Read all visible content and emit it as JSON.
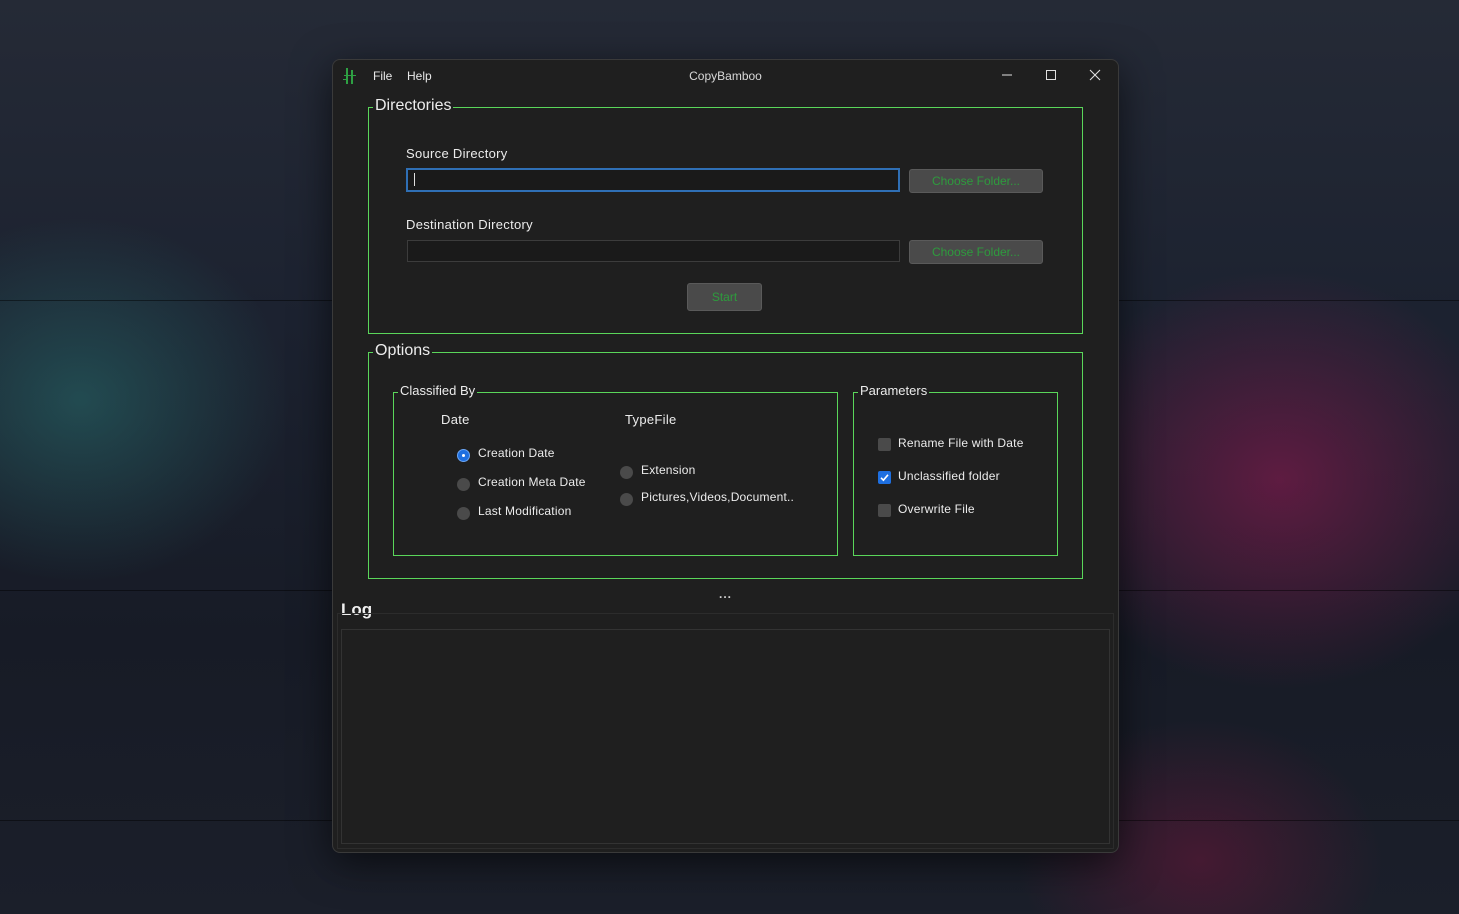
{
  "window": {
    "title": "CopyBamboo",
    "menu": [
      "File",
      "Help"
    ]
  },
  "directories": {
    "title": "Directories",
    "source_label": "Source Directory",
    "source_value": "",
    "destination_label": "Destination Directory",
    "destination_value": "",
    "choose_folder_label": "Choose Folder...",
    "start_label": "Start"
  },
  "options": {
    "title": "Options",
    "classified_by": {
      "title": "Classified By",
      "date_heading": "Date",
      "typefile_heading": "TypeFile",
      "date_options": [
        {
          "label": "Creation Date",
          "checked": true
        },
        {
          "label": "Creation Meta Date",
          "checked": false
        },
        {
          "label": "Last Modification",
          "checked": false
        }
      ],
      "typefile_options": [
        {
          "label": "Extension",
          "checked": false
        },
        {
          "label": "Pictures,Videos,Document..",
          "checked": false
        }
      ]
    },
    "parameters": {
      "title": "Parameters",
      "items": [
        {
          "label": "Rename File with Date",
          "checked": false
        },
        {
          "label": "Unclassified folder",
          "checked": true
        },
        {
          "label": "Overwrite File",
          "checked": false
        }
      ]
    }
  },
  "splitter_handle": "...",
  "log": {
    "title": "Log",
    "content": ""
  },
  "colors": {
    "group_border": "#5ad65a",
    "button_text": "#2e9b3d",
    "accent_blue": "#1e6fe0"
  }
}
